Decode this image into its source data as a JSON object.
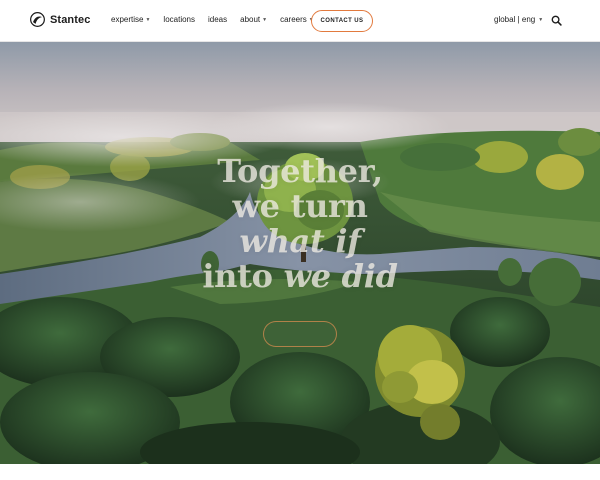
{
  "header": {
    "brand": "Stantec",
    "nav": [
      {
        "label": "expertise",
        "has_dropdown": true
      },
      {
        "label": "locations",
        "has_dropdown": false
      },
      {
        "label": "ideas",
        "has_dropdown": false
      },
      {
        "label": "about",
        "has_dropdown": true
      },
      {
        "label": "careers",
        "has_dropdown": true
      }
    ],
    "cta_label": "CONTACT US",
    "locale_label": "global | eng",
    "search_icon": "search-icon"
  },
  "hero": {
    "headline": [
      "Together,",
      "we turn",
      "what if",
      "into",
      "we did"
    ],
    "button_label": "",
    "image": "aerial river landscape with misty forest and single tree"
  },
  "colors": {
    "accent": "#e27a3e",
    "header_bg": "#ffffff",
    "text": "#1d1d1d",
    "headline_text": "#f0ece4"
  }
}
